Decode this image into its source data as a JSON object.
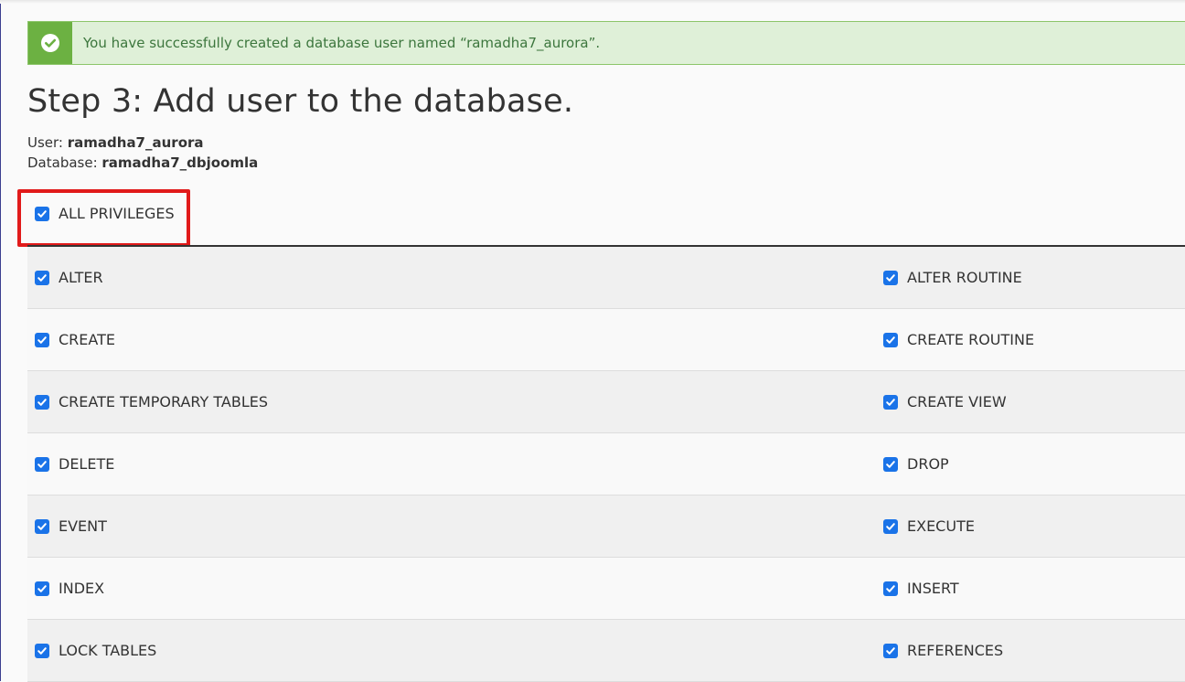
{
  "alert": {
    "icon": "check-circle-icon",
    "message": "You have successfully created a database user named “ramadha7_aurora”."
  },
  "page": {
    "title": "Step 3: Add user to the database."
  },
  "meta": {
    "user_label": "User: ",
    "user_value": "ramadha7_aurora",
    "database_label": "Database: ",
    "database_value": "ramadha7_dbjoomla"
  },
  "all_privileges": {
    "label": "ALL PRIVILEGES",
    "checked": true
  },
  "privileges": [
    {
      "left": "ALTER",
      "right": "ALTER ROUTINE"
    },
    {
      "left": "CREATE",
      "right": "CREATE ROUTINE"
    },
    {
      "left": "CREATE TEMPORARY TABLES",
      "right": "CREATE VIEW"
    },
    {
      "left": "DELETE",
      "right": "DROP"
    },
    {
      "left": "EVENT",
      "right": "EXECUTE"
    },
    {
      "left": "INDEX",
      "right": "INSERT"
    },
    {
      "left": "LOCK TABLES",
      "right": "REFERENCES"
    }
  ],
  "colors": {
    "checkbox": "#1a73e8",
    "alert_bg": "#dff0d8",
    "alert_icon_bg": "#6cb142",
    "highlight": "#e11a1a"
  }
}
